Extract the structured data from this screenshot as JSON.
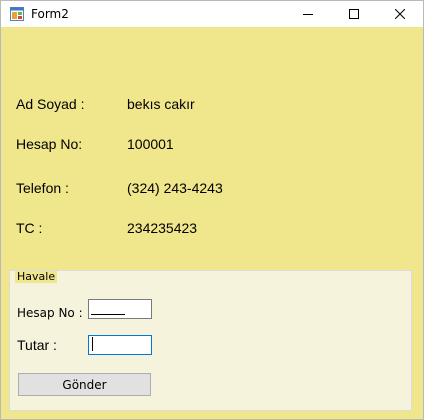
{
  "window": {
    "title": "Form2",
    "background_color": "#f0e68c",
    "buttons": [
      "minimize",
      "maximize",
      "close"
    ]
  },
  "info": {
    "name_label": "Ad Soyad :",
    "name_value": "bekıs cakır",
    "account_label": "Hesap No:",
    "account_value": "100001",
    "phone_label": "Telefon :",
    "phone_value": "(324) 243-4243",
    "tc_label": "TC :",
    "tc_value": "234235423"
  },
  "transfer": {
    "group_title": "Havale",
    "account_label": "Hesap No :",
    "account_input_value": "",
    "amount_label": "Tutar :",
    "amount_input_value": "",
    "send_button_label": "Gönder"
  },
  "icons": {
    "app": "form-app-icon",
    "minimize": "minimize-icon",
    "maximize": "maximize-icon",
    "close": "close-icon"
  }
}
